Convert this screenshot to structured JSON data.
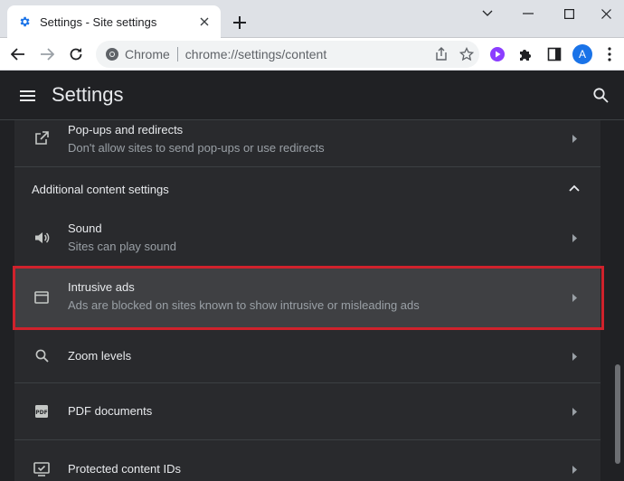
{
  "tab": {
    "title": "Settings - Site settings"
  },
  "toolbar": {
    "site_label": "Chrome",
    "url": "chrome://settings/content",
    "avatar_letter": "A"
  },
  "header": {
    "title": "Settings"
  },
  "content": {
    "popups": {
      "title": "Pop-ups and redirects",
      "subtitle": "Don't allow sites to send pop-ups or use redirects"
    },
    "additional_section": {
      "label": "Additional content settings"
    },
    "sound": {
      "title": "Sound",
      "subtitle": "Sites can play sound"
    },
    "intrusive_ads": {
      "title": "Intrusive ads",
      "subtitle": "Ads are blocked on sites known to show intrusive or misleading ads"
    },
    "zoom": {
      "title": "Zoom levels"
    },
    "pdf": {
      "title": "PDF documents"
    },
    "protected": {
      "title": "Protected content IDs"
    }
  },
  "colors": {
    "highlight_border": "#d0222c",
    "accent": "#1a73e8",
    "extension_purple": "#8b3dff"
  },
  "icons": {
    "tab_favicon": "gear-icon",
    "popups": "open-in-new-icon",
    "sound": "volume-icon",
    "intrusive_ads": "window-icon",
    "zoom": "magnifier-icon",
    "pdf": "pdf-icon",
    "protected": "monitor-check-icon"
  }
}
